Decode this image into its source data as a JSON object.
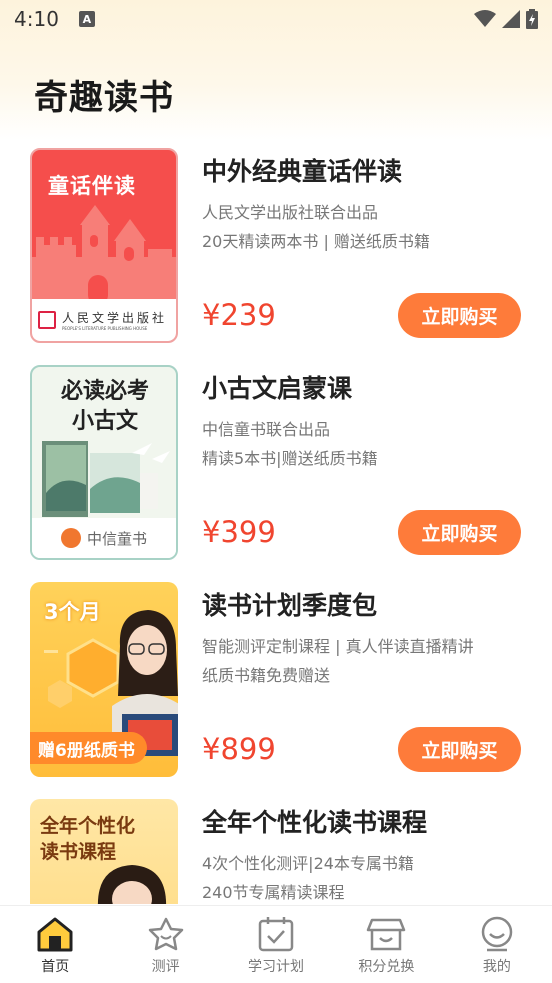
{
  "status": {
    "time": "4:10",
    "notif": "A"
  },
  "page": {
    "title": "奇趣读书"
  },
  "products": [
    {
      "title": "中外经典童话伴读",
      "line1": "人民文学出版社联合出品",
      "line2": "20天精读两本书 | 赠送纸质书籍",
      "price": "¥239",
      "button": "立即购买",
      "cover": {
        "headline": "童话伴读",
        "publisher_cn": "人民文学出版社",
        "publisher_en": "PEOPLE'S LITERATURE PUBLISHING HOUSE"
      }
    },
    {
      "title": "小古文启蒙课",
      "line1": "中信童书联合出品",
      "line2": "精读5本书|赠送纸质书籍",
      "price": "¥399",
      "button": "立即购买",
      "cover": {
        "headline1": "必读必考",
        "headline2": "小古文",
        "brand": "中信童书"
      }
    },
    {
      "title": "读书计划季度包",
      "line1": "智能测评定制课程 | 真人伴读直播精讲",
      "line2": "纸质书籍免费赠送",
      "price": "¥899",
      "button": "立即购买",
      "cover": {
        "tag": "3个月",
        "banner": "赠6册纸质书"
      }
    },
    {
      "title": "全年个性化读书课程",
      "line1": "4次个性化测评|24本专属书籍",
      "line2": "240节专属精读课程",
      "price": "",
      "button": "",
      "cover": {
        "headline1": "全年个性化",
        "headline2": "读书课程"
      }
    }
  ],
  "tabs": [
    {
      "label": "首页",
      "icon": "home-icon",
      "active": true
    },
    {
      "label": "测评",
      "icon": "star-badge-icon",
      "active": false
    },
    {
      "label": "学习计划",
      "icon": "calendar-check-icon",
      "active": false
    },
    {
      "label": "积分兑换",
      "icon": "store-icon",
      "active": false
    },
    {
      "label": "我的",
      "icon": "profile-icon",
      "active": false
    }
  ],
  "colors": {
    "accent": "#fe7b3a",
    "price": "#f0452f",
    "cover1": "#f54e4c",
    "cover3": "#ffc43f"
  }
}
